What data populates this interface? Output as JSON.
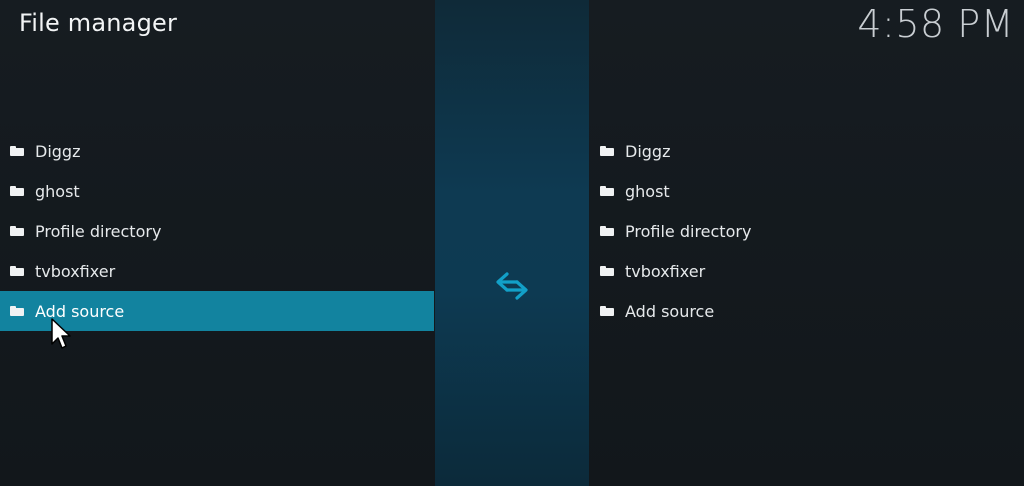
{
  "header": {
    "title": "File manager",
    "clock": "4:58 PM"
  },
  "left_pane": {
    "items": [
      {
        "label": "Diggz",
        "icon": "folder-icon"
      },
      {
        "label": "ghost",
        "icon": "folder-icon"
      },
      {
        "label": "Profile directory",
        "icon": "folder-icon"
      },
      {
        "label": "tvboxfixer",
        "icon": "folder-icon"
      },
      {
        "label": "Add source",
        "icon": "folder-icon",
        "selected": true
      }
    ]
  },
  "right_pane": {
    "items": [
      {
        "label": "Diggz",
        "icon": "folder-icon"
      },
      {
        "label": "ghost",
        "icon": "folder-icon"
      },
      {
        "label": "Profile directory",
        "icon": "folder-icon"
      },
      {
        "label": "tvboxfixer",
        "icon": "folder-icon"
      },
      {
        "label": "Add source",
        "icon": "folder-icon"
      }
    ]
  },
  "center": {
    "icon": "swap-arrows-icon",
    "accent_color": "#12a0c8"
  },
  "colors": {
    "selection": "#12839f",
    "background": "#141a1f",
    "center_band": "#0e3a52"
  }
}
